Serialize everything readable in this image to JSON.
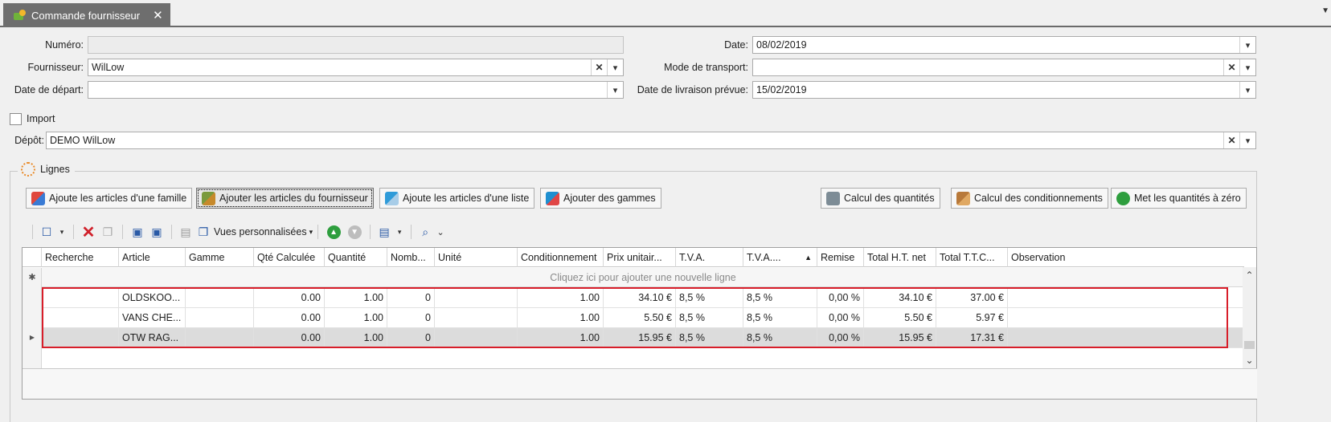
{
  "tab": {
    "title": "Commande fournisseur",
    "close": "✕"
  },
  "form": {
    "numero_label": "Numéro:",
    "numero_value": "",
    "fournisseur_label": "Fournisseur:",
    "fournisseur_value": "WilLow",
    "date_depart_label": "Date de départ:",
    "date_depart_value": "",
    "date_label": "Date:",
    "date_value": "08/02/2019",
    "transport_label": "Mode de transport:",
    "transport_value": "",
    "livraison_label": "Date de livraison prévue:",
    "livraison_value": "15/02/2019",
    "import_label": "Import",
    "depot_label": "Dépôt:",
    "depot_value": "DEMO WilLow"
  },
  "group": {
    "title": "Lignes"
  },
  "actions": {
    "famille": "Ajoute les articles d'une famille",
    "fournisseur": "Ajouter les articles du fournisseur",
    "liste": "Ajoute les articles d'une liste",
    "gammes": "Ajouter des gammes",
    "calc_quantites": "Calcul des quantités",
    "calc_conditionnements": "Calcul des conditionnements",
    "reset": "Met les quantités à zéro"
  },
  "toolbar": {
    "vues": "Vues personnalisées"
  },
  "grid": {
    "headers": [
      "Recherche",
      "Article",
      "Gamme",
      "Qté Calculée",
      "Quantité",
      "Nomb...",
      "Unité",
      "Conditionnement",
      "Prix unitair...",
      "T.V.A.",
      "T.V.A....",
      "Remise",
      "Total H.T. net",
      "Total T.T.C...",
      "Observation"
    ],
    "new_row": "Cliquez ici pour ajouter une nouvelle ligne",
    "rows": [
      [
        "",
        "OLDSKOO...",
        "",
        "0.00",
        "1.00",
        "0",
        "",
        "1.00",
        "34.10 €",
        "8,5 %",
        "8,5 %",
        "0,00 %",
        "34.10 €",
        "37.00 €",
        ""
      ],
      [
        "",
        "VANS CHE...",
        "",
        "0.00",
        "1.00",
        "0",
        "",
        "1.00",
        "5.50 €",
        "8,5 %",
        "8,5 %",
        "0,00 %",
        "5.50 €",
        "5.97 €",
        ""
      ],
      [
        "",
        "OTW RAG...",
        "",
        "0.00",
        "1.00",
        "0",
        "",
        "1.00",
        "15.95 €",
        "8,5 %",
        "8,5 %",
        "0,00 %",
        "15.95 €",
        "17.31 €",
        ""
      ]
    ]
  },
  "colors": {
    "highlight": "#d81e2a",
    "tab_bg": "#6e6e6e",
    "selected_row": "#dcdcdc"
  }
}
